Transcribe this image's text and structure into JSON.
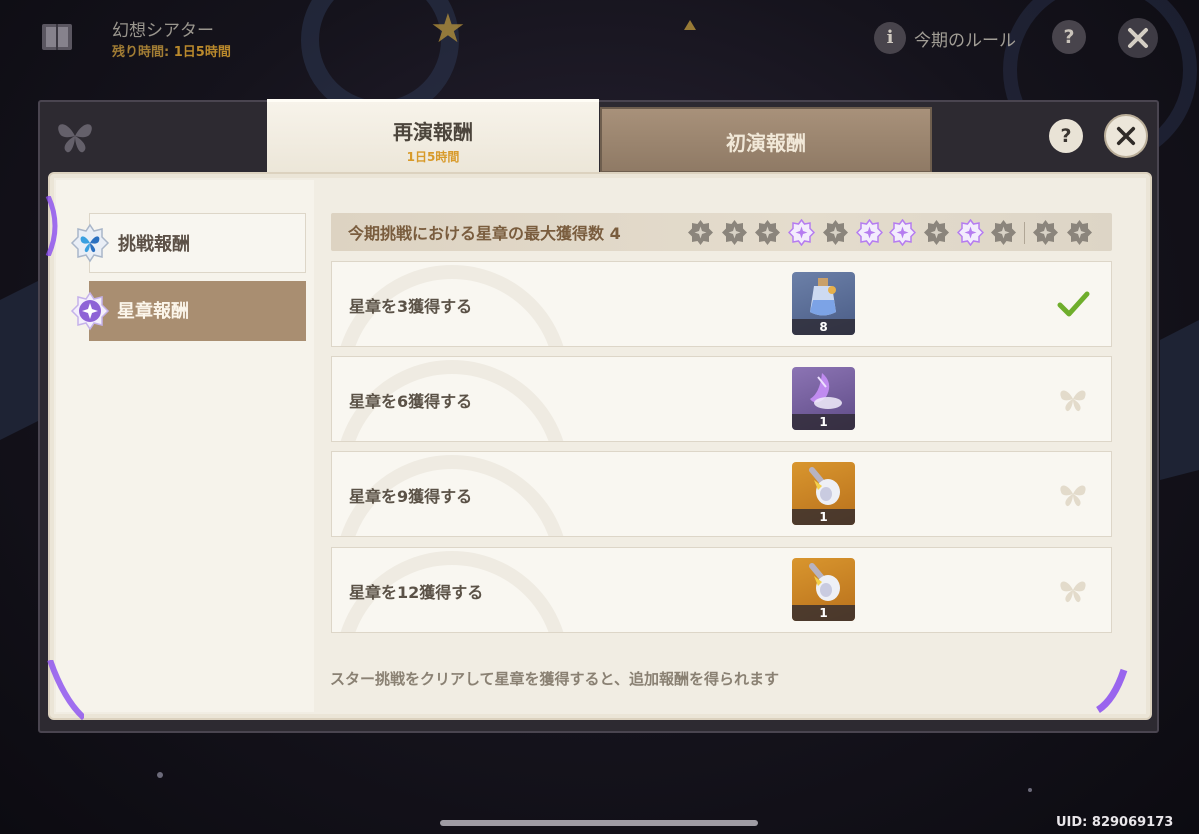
{
  "event": {
    "title": "幻想シアター",
    "timer_label": "残り時間:",
    "timer_value": "1日5時間",
    "rules_label": "今期のルール"
  },
  "tabs": [
    {
      "label": "再演報酬",
      "sublabel": "1日5時間",
      "active": true
    },
    {
      "label": "初演報酬",
      "active": false
    }
  ],
  "sidebar": {
    "items": [
      {
        "label": "挑戦報酬",
        "active": false
      },
      {
        "label": "星章報酬",
        "active": true
      }
    ]
  },
  "progress": {
    "header": "今期挑戦における星章の最大獲得数 4",
    "stars_total": 12,
    "stars_lit": [
      4,
      6,
      7,
      9
    ]
  },
  "rewards": [
    {
      "label": "星章を3獲得する",
      "item": "potion-bottle",
      "count": "8",
      "status": "claimed"
    },
    {
      "label": "星章を6獲得する",
      "item": "purple-crystal",
      "count": "1",
      "status": "locked"
    },
    {
      "label": "星章を9獲得する",
      "item": "golden-vial",
      "count": "1",
      "status": "locked"
    },
    {
      "label": "星章を12獲得する",
      "item": "golden-vial",
      "count": "1",
      "status": "locked"
    }
  ],
  "footer": "スター挑戦をクリアして星章を獲得すると、追加報酬を得られます",
  "uid": "UID: 829069173",
  "colors": {
    "accent_gold": "#d89a2a",
    "active_side": "#a98e71",
    "check_green": "#6fae2c",
    "star_lit": "#b57cf0"
  }
}
